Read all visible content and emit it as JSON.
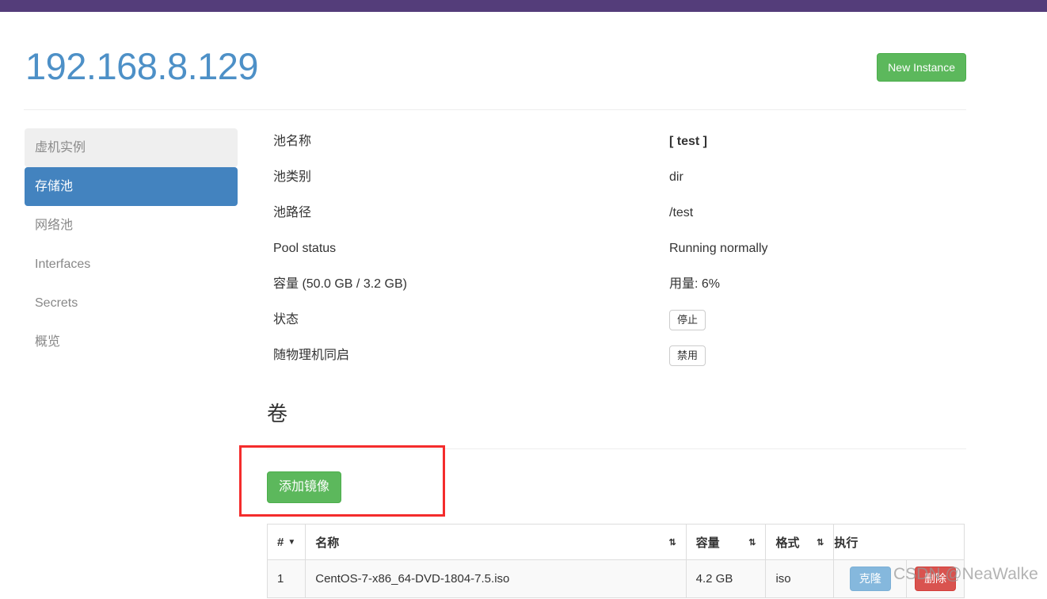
{
  "topbar": {
    "color": "#543d7a"
  },
  "header": {
    "title": "192.168.8.129",
    "title_color": "#4d90c7",
    "new_instance_label": "New Instance",
    "new_instance_color": "#5cb85c"
  },
  "sidebar": {
    "items": [
      {
        "label": "虚机实例",
        "state": "hovered"
      },
      {
        "label": "存储池",
        "state": "active"
      },
      {
        "label": "网络池",
        "state": "normal"
      },
      {
        "label": "Interfaces",
        "state": "normal"
      },
      {
        "label": "Secrets",
        "state": "normal"
      },
      {
        "label": "概览",
        "state": "normal"
      }
    ],
    "active_color": "#4383bf",
    "hover_color": "#efefef"
  },
  "details": {
    "rows": [
      {
        "label": "池名称",
        "value": "[ test ]",
        "type": "strong"
      },
      {
        "label": "池类别",
        "value": "dir",
        "type": "text"
      },
      {
        "label": "池路径",
        "value": "/test",
        "type": "text"
      },
      {
        "label": "Pool status",
        "value": "Running normally",
        "type": "text"
      },
      {
        "label": "容量 (50.0 GB / 3.2 GB)",
        "value": "用量: 6%",
        "type": "text"
      },
      {
        "label": "状态",
        "value": "停止",
        "type": "button"
      },
      {
        "label": "随物理机同启",
        "value": "禁用",
        "type": "button"
      }
    ]
  },
  "volumes": {
    "heading": "卷",
    "add_image_label": "添加镜像",
    "add_image_color": "#5cb85c",
    "annotation_color": "#f42c2c",
    "table": {
      "headers": [
        {
          "label": "#",
          "sort": "desc"
        },
        {
          "label": "名称",
          "sort": "both"
        },
        {
          "label": "容量",
          "sort": "both"
        },
        {
          "label": "格式",
          "sort": "both"
        },
        {
          "label": "执行",
          "sort": "none"
        }
      ],
      "sort_desc_glyph": "▼",
      "sort_both_glyph": "⇅",
      "rows": [
        {
          "index": "1",
          "name": "CentOS-7-x86_64-DVD-1804-7.5.iso",
          "capacity": "4.2 GB",
          "format": "iso",
          "clone_label": "克隆",
          "delete_label": "删除"
        }
      ]
    },
    "clone_color": "#85b8dd",
    "delete_color": "#d9534f"
  },
  "watermark": {
    "text": "CSDN @NeaWalke"
  }
}
